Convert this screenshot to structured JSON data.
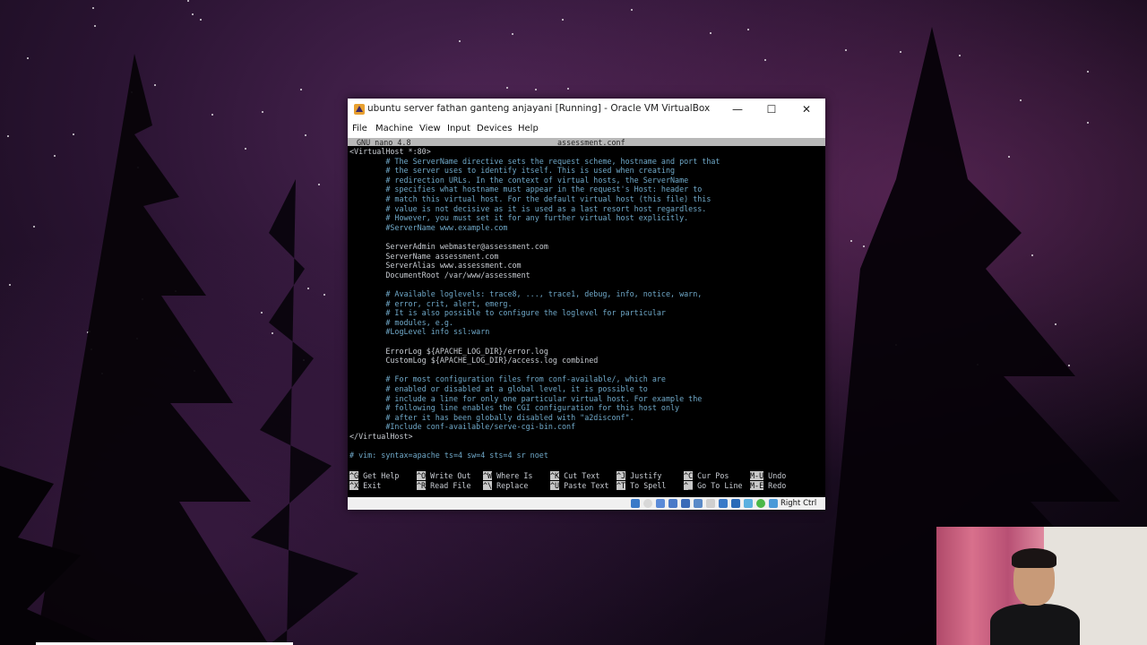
{
  "window": {
    "title": "ubuntu server fathan ganteng anjayani [Running] - Oracle VM VirtualBox",
    "minimize": "—",
    "maximize": "☐",
    "close": "✕"
  },
  "menu": [
    "File",
    "Machine",
    "View",
    "Input",
    "Devices",
    "Help"
  ],
  "nano": {
    "version": "GNU nano 4.8",
    "filename": "assessment.conf",
    "lines": [
      {
        "text": "<VirtualHost *:80>",
        "kind": "tag"
      },
      {
        "text": "        # The ServerName directive sets the request scheme, hostname and port that",
        "kind": "comment"
      },
      {
        "text": "        # the server uses to identify itself. This is used when creating",
        "kind": "comment"
      },
      {
        "text": "        # redirection URLs. In the context of virtual hosts, the ServerName",
        "kind": "comment"
      },
      {
        "text": "        # specifies what hostname must appear in the request's Host: header to",
        "kind": "comment"
      },
      {
        "text": "        # match this virtual host. For the default virtual host (this file) this",
        "kind": "comment"
      },
      {
        "text": "        # value is not decisive as it is used as a last resort host regardless.",
        "kind": "comment"
      },
      {
        "text": "        # However, you must set it for any further virtual host explicitly.",
        "kind": "comment"
      },
      {
        "text": "        #ServerName www.example.com",
        "kind": "comment"
      },
      {
        "text": "",
        "kind": "text"
      },
      {
        "text": "        ServerAdmin webmaster@assessment.com",
        "kind": "text"
      },
      {
        "text": "        ServerName assessment.com",
        "kind": "text"
      },
      {
        "text": "        ServerAlias www.assessment.com",
        "kind": "text"
      },
      {
        "text": "        DocumentRoot /var/www/assessment",
        "kind": "text"
      },
      {
        "text": "",
        "kind": "text"
      },
      {
        "text": "        # Available loglevels: trace8, ..., trace1, debug, info, notice, warn,",
        "kind": "comment"
      },
      {
        "text": "        # error, crit, alert, emerg.",
        "kind": "comment"
      },
      {
        "text": "        # It is also possible to configure the loglevel for particular",
        "kind": "comment"
      },
      {
        "text": "        # modules, e.g.",
        "kind": "comment"
      },
      {
        "text": "        #LogLevel info ssl:warn",
        "kind": "comment"
      },
      {
        "text": "",
        "kind": "text"
      },
      {
        "text": "        ErrorLog ${APACHE_LOG_DIR}/error.log",
        "kind": "text"
      },
      {
        "text": "        CustomLog ${APACHE_LOG_DIR}/access.log combined",
        "kind": "text"
      },
      {
        "text": "",
        "kind": "text"
      },
      {
        "text": "        # For most configuration files from conf-available/, which are",
        "kind": "comment"
      },
      {
        "text": "        # enabled or disabled at a global level, it is possible to",
        "kind": "comment"
      },
      {
        "text": "        # include a line for only one particular virtual host. For example the",
        "kind": "comment"
      },
      {
        "text": "        # following line enables the CGI configuration for this host only",
        "kind": "comment"
      },
      {
        "text": "        # after it has been globally disabled with \"a2disconf\".",
        "kind": "comment"
      },
      {
        "text": "        #Include conf-available/serve-cgi-bin.conf",
        "kind": "comment"
      },
      {
        "text": "</VirtualHost>",
        "kind": "tag"
      },
      {
        "text": "",
        "kind": "text"
      },
      {
        "text": "# vim: syntax=apache ts=4 sw=4 sts=4 sr noet",
        "kind": "comment"
      }
    ],
    "shortcuts": [
      [
        {
          "key": "^G",
          "label": "Get Help"
        },
        {
          "key": "^X",
          "label": "Exit"
        }
      ],
      [
        {
          "key": "^O",
          "label": "Write Out"
        },
        {
          "key": "^R",
          "label": "Read File"
        }
      ],
      [
        {
          "key": "^W",
          "label": "Where Is"
        },
        {
          "key": "^\\",
          "label": "Replace"
        }
      ],
      [
        {
          "key": "^K",
          "label": "Cut Text"
        },
        {
          "key": "^U",
          "label": "Paste Text"
        }
      ],
      [
        {
          "key": "^J",
          "label": "Justify"
        },
        {
          "key": "^T",
          "label": "To Spell"
        }
      ],
      [
        {
          "key": "^C",
          "label": "Cur Pos"
        },
        {
          "key": "^_",
          "label": "Go To Line"
        }
      ],
      [
        {
          "key": "M-U",
          "label": "Undo"
        },
        {
          "key": "M-E",
          "label": "Redo"
        }
      ]
    ]
  },
  "statusbar": {
    "host_key": "Right Ctrl"
  },
  "colors": {
    "comment": "#6fa8c8",
    "text": "#c8ccd2",
    "nano_bar": "#b8b8b8"
  }
}
